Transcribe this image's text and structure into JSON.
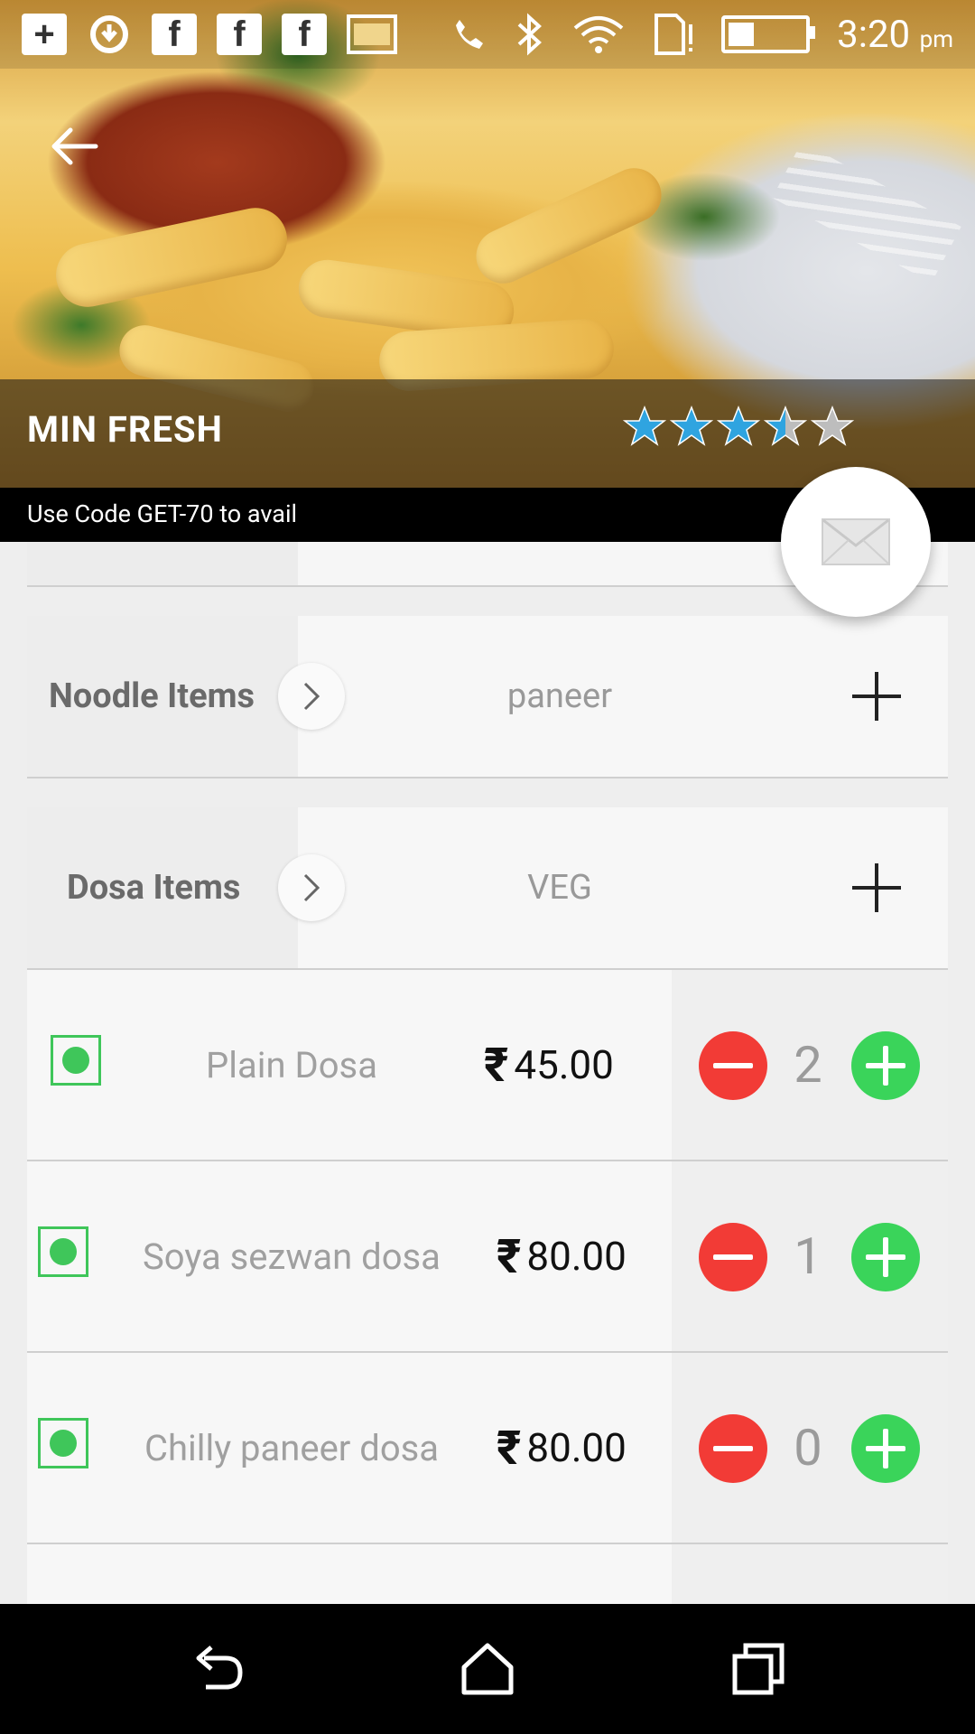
{
  "status_bar": {
    "time": "3:20",
    "ampm": "pm",
    "icons": [
      "add-notification-icon",
      "sync-icon",
      "facebook-icon",
      "facebook-icon",
      "facebook-icon",
      "image-icon",
      "phone-muted-icon",
      "bluetooth-icon",
      "wifi-icon",
      "sim-alert-icon",
      "battery-icon"
    ]
  },
  "restaurant": {
    "name": "MIN FRESH",
    "rating": 3.5,
    "rating_max": 5,
    "promo": "Use Code GET-70 to avail"
  },
  "colors": {
    "star_filled": "#2fa4e0",
    "star_empty": "#bdbdbd",
    "veg_green": "#3fc65a",
    "minus_red": "#f23b36",
    "plus_green": "#3ad45a"
  },
  "categories": [
    {
      "name": "Noodle Items",
      "tag": "paneer"
    },
    {
      "name": "Dosa Items",
      "tag": "VEG"
    }
  ],
  "items": [
    {
      "name": "Plain Dosa",
      "price": "45.00",
      "currency": "₹",
      "qty": "2"
    },
    {
      "name": "Soya sezwan dosa",
      "price": "80.00",
      "currency": "₹",
      "qty": "1"
    },
    {
      "name": "Chilly paneer dosa",
      "price": "80.00",
      "currency": "₹",
      "qty": "0"
    }
  ],
  "nav": [
    "back-icon",
    "home-icon",
    "recents-icon"
  ]
}
